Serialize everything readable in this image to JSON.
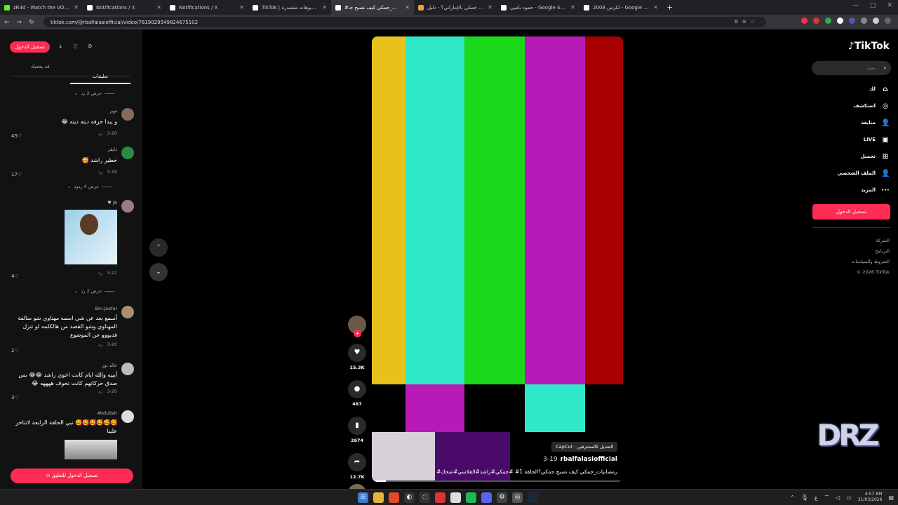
{
  "browser": {
    "tabs": [
      {
        "title": "zR3d - Watch the VOD on Kick",
        "color": "#53fc18",
        "active": false
      },
      {
        "title": "Notifications / X",
        "color": "#ffffff",
        "active": false
      },
      {
        "title": "Notifications / X",
        "color": "#ffffff",
        "active": false
      },
      {
        "title": "TikTok | شاهد فيديوهات متصدرة",
        "color": "#ffffff",
        "active": false
      },
      {
        "title": "#رمضانيات_جمكي كيف تصبح جـ",
        "color": "#ffffff",
        "active": true
      },
      {
        "title": "ما معنى جمكي بالإماراتي؟ - دليل",
        "color": "#e8a33d",
        "active": false
      },
      {
        "title": "حمود باميي - Google Search",
        "color": "#ffffff",
        "active": false
      },
      {
        "title": "لكزس 2008 - Google Search",
        "color": "#ffffff",
        "active": false
      }
    ],
    "url": "tiktok.com/@rbalfalasiofficial/video/7619029549824675102"
  },
  "left": {
    "login_pill": "تسجيل الدخول",
    "tab_comments": "تعليقات",
    "tab_related": "قد يعجبك",
    "view_replies_2a": "عرض 2 رد",
    "view_replies_4": "عرض 4 ردود",
    "view_replies_2b": "عرض 2 رد",
    "reply": "رد",
    "comments": [
      {
        "name": "توير",
        "text": "و يبدا حرفه ديته ديته 😂",
        "date": "3-20",
        "likes": "45"
      },
      {
        "name": "دايقر",
        "text": "خطير راشد 🥰",
        "date": "3-19",
        "likes": "17"
      },
      {
        "name": "J6 ♥",
        "text": "",
        "date": "3-21",
        "likes": "4"
      },
      {
        "name": "Bin.Jaafar",
        "text": "أسمع بعد عن شي اسمه مهناوي شو سالفة المهناوي وشو القصد من هالكلمه لو تنزل فديووو عن الموضوع",
        "date": "3-20",
        "likes": "2"
      },
      {
        "name": "خالد نور",
        "text": "أيييه والله ايام كانت اخوي راشد 😂😂 بس صدق حركاتهم كانت تخوف ههههه 😂",
        "date": "3-20",
        "likes": "3"
      },
      {
        "name": "Abdullah",
        "text": "🥰🥰🥰🥰🥰🥰 نبي الحلقة الرابعة لاتتاخر علينا",
        "date": "",
        "likes": ""
      }
    ],
    "login_to_comment": "تسجيل الدخول للتعليق"
  },
  "video": {
    "capcut": "CapCut · التعديل كالمحترفين",
    "username": "rbalfalasiofficial",
    "date": "3-19",
    "caption": "#رمضانيات_جمكي كيف تصبح جمكي؟الحلقة 1# #جمكي#راشد#الفلاسي#ضحك",
    "bar_colors": [
      "#e8c21a",
      "#2ee8c8",
      "#1ad81a",
      "#b81ab8",
      "#a80000"
    ],
    "lower_colors": [
      "#000000",
      "#b81ab8",
      "#000000",
      "#2ee8c8",
      "#000000"
    ]
  },
  "actions": {
    "likes": "15.3K",
    "comments": "467",
    "saves": "2674",
    "shares": "12.7K"
  },
  "right": {
    "logo": "TikTok",
    "search_placeholder": "بحث",
    "menu": [
      {
        "label": "لك",
        "icon": "home-icon",
        "glyph": "⌂"
      },
      {
        "label": "استكشف",
        "icon": "compass-icon",
        "glyph": "◎"
      },
      {
        "label": "متابعة",
        "icon": "following-icon",
        "glyph": "👤"
      },
      {
        "label": "LIVE",
        "icon": "live-icon",
        "glyph": "▣"
      },
      {
        "label": "تحميل",
        "icon": "upload-icon",
        "glyph": "⊞"
      },
      {
        "label": "الملف الشخصي",
        "icon": "profile-icon",
        "glyph": "👤"
      },
      {
        "label": "المزيد",
        "icon": "more-icon",
        "glyph": "···"
      }
    ],
    "login": "تسجيل الدخول",
    "footer": [
      "الشركة",
      "البرنامج",
      "الشروط والسياسات",
      "© 2026 TikTok"
    ]
  },
  "watermark": "DRZ",
  "taskbar": {
    "time": "4:57 AM",
    "date": "31/03/2026",
    "lang": "ع"
  }
}
